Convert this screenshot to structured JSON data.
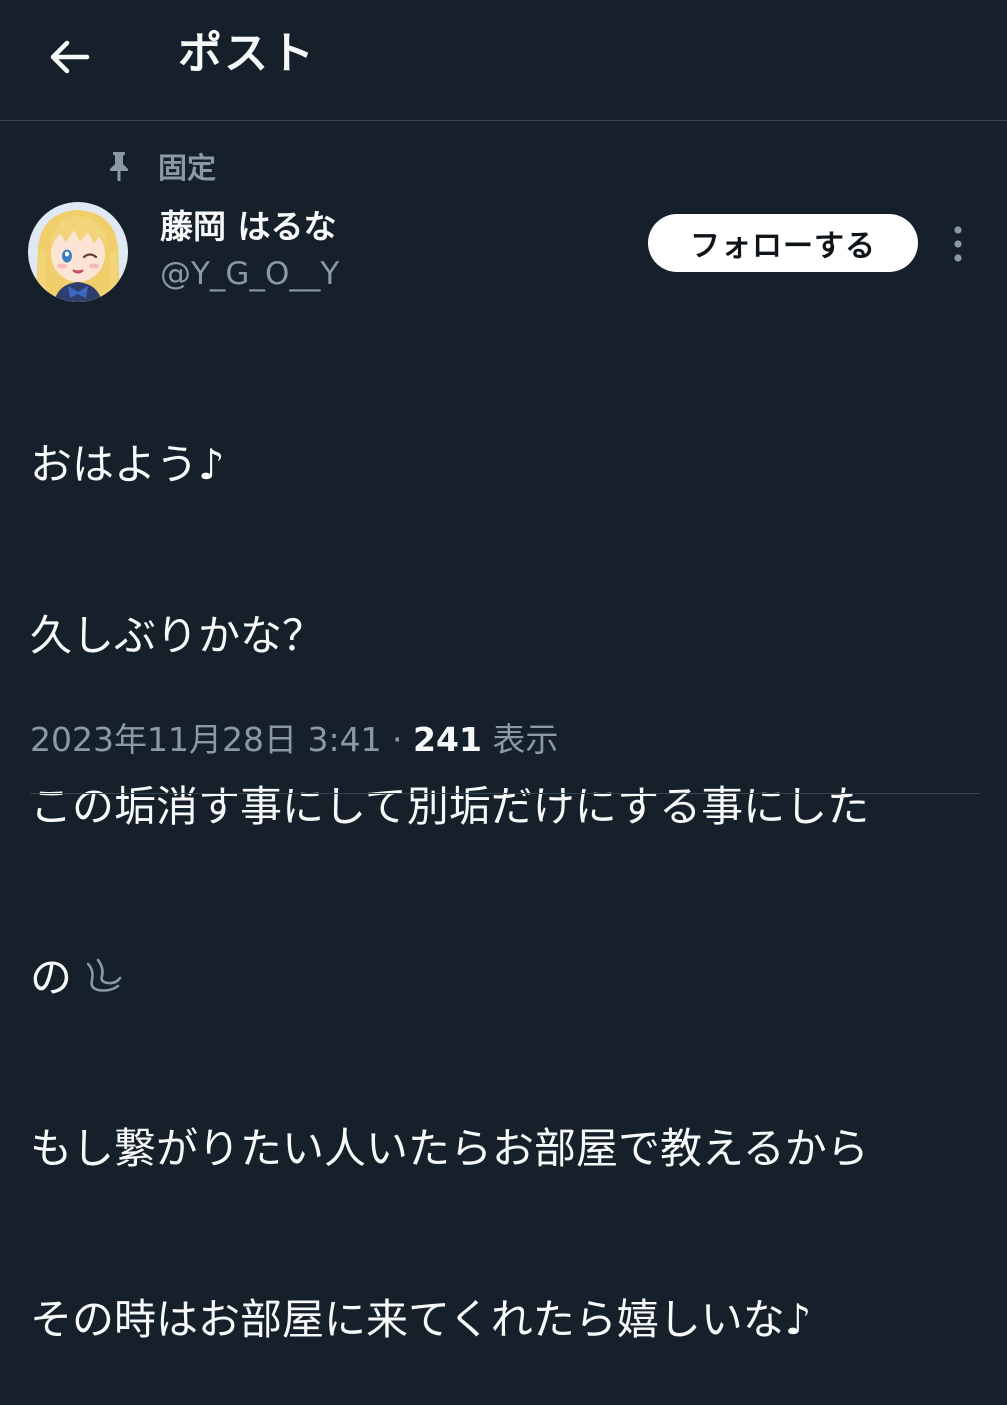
{
  "header": {
    "title": "ポスト"
  },
  "pinned": {
    "label": "固定"
  },
  "author": {
    "display_name": "藤岡 はるな",
    "handle": "@Y_G_O__Y"
  },
  "follow_button": {
    "label": "フォローする"
  },
  "tweet": {
    "lines": [
      "おはよう♪",
      "久しぶりかな？",
      "この垢消す事にして別垢だけにする事にした",
      "の",
      "もし繋がりたい人いたらお部屋で教えるから",
      "その時はお部屋に来てくれたら嬉しいな♪"
    ]
  },
  "meta": {
    "timestamp": "2023年11月28日 3:41",
    "separator": " · ",
    "views_count": "241",
    "views_label": " 表示"
  },
  "colors": {
    "background": "#15202b",
    "text": "#f7f9f9",
    "secondary": "#8b98a5",
    "divider": "#38444d",
    "follow_bg": "#ffffff",
    "follow_text": "#0f1419"
  },
  "icons": {
    "back": "arrow-left-icon",
    "pin": "pin-icon",
    "more": "more-vertical-icon",
    "sweat": "sweat-droplet-icon"
  }
}
